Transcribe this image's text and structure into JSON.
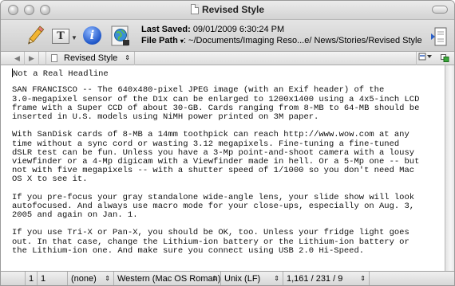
{
  "window": {
    "title": "Revised Style"
  },
  "toolbar": {
    "last_saved_label": "Last Saved:",
    "last_saved_value": "09/01/2009 6:30:24 PM",
    "file_path_label": "File Path",
    "file_path_arrow": "▾",
    "file_path_value": ": ~/Documents/Imaging Reso...e/ News/Stories/Revised Style",
    "text_icon_glyph": "T",
    "info_icon_glyph": "i"
  },
  "navbar": {
    "back": "◀",
    "forward": "▶",
    "document": "Revised Style",
    "popup_arrow": "⇕"
  },
  "editor": {
    "lines": [
      "Not a Real Headline",
      "",
      "SAN FRANCISCO -- The 640x480-pixel JPEG image (with an Exif header) of the",
      "3.0-megapixel sensor of the D1x can be enlarged to 1200x1400 using a 4x5-inch LCD",
      "frame with a Super CCD of about 30-GB. Cards ranging from 8-MB to 64-MB should be",
      "inserted in U.S. models using NiMH power printed on 3M paper.",
      "",
      "With SanDisk cards of 8-MB a 14mm toothpick can reach http://www.wow.com at any",
      "time without a sync cord or wasting 3.12 megapixels. Fine-tuning a fine-tuned",
      "dSLR test can be fun. Unless you have a 3-Mp point-and-shoot camera with a lousy",
      "viewfinder or a 4-Mp digicam with a Viewfinder made in hell. Or a 5-Mp one -- but",
      "not with five megapixels -- with a shutter speed of 1/1000 so you don't need Mac",
      "OS X to see it.",
      "",
      "If you pre-focus your gray standalone wide-angle lens, your slide show will look",
      "autofocused. And always use macro mode for your close-ups, especially on Aug. 3,",
      "2005 and again on Jan. 1.",
      "",
      "If you use Tri-X or Pan-X, you should be OK, too. Unless your fridge light goes",
      "out. In that case, change the Lithium-ion battery or the Lithium-ion battery or",
      "the Lithium-ion one. And make sure you connect using USB 2.0 Hi-Speed."
    ]
  },
  "statusbar": {
    "line": "1",
    "column": "1",
    "mode": "(none)",
    "encoding": "Western (Mac OS Roman)",
    "line_endings": "Unix (LF)",
    "counts": "1,161 / 231 / 9",
    "popup_arrow": "⇕"
  },
  "colors": {
    "info_blue": "#1f56c8",
    "chrome_gray": "#d2d2d2"
  }
}
